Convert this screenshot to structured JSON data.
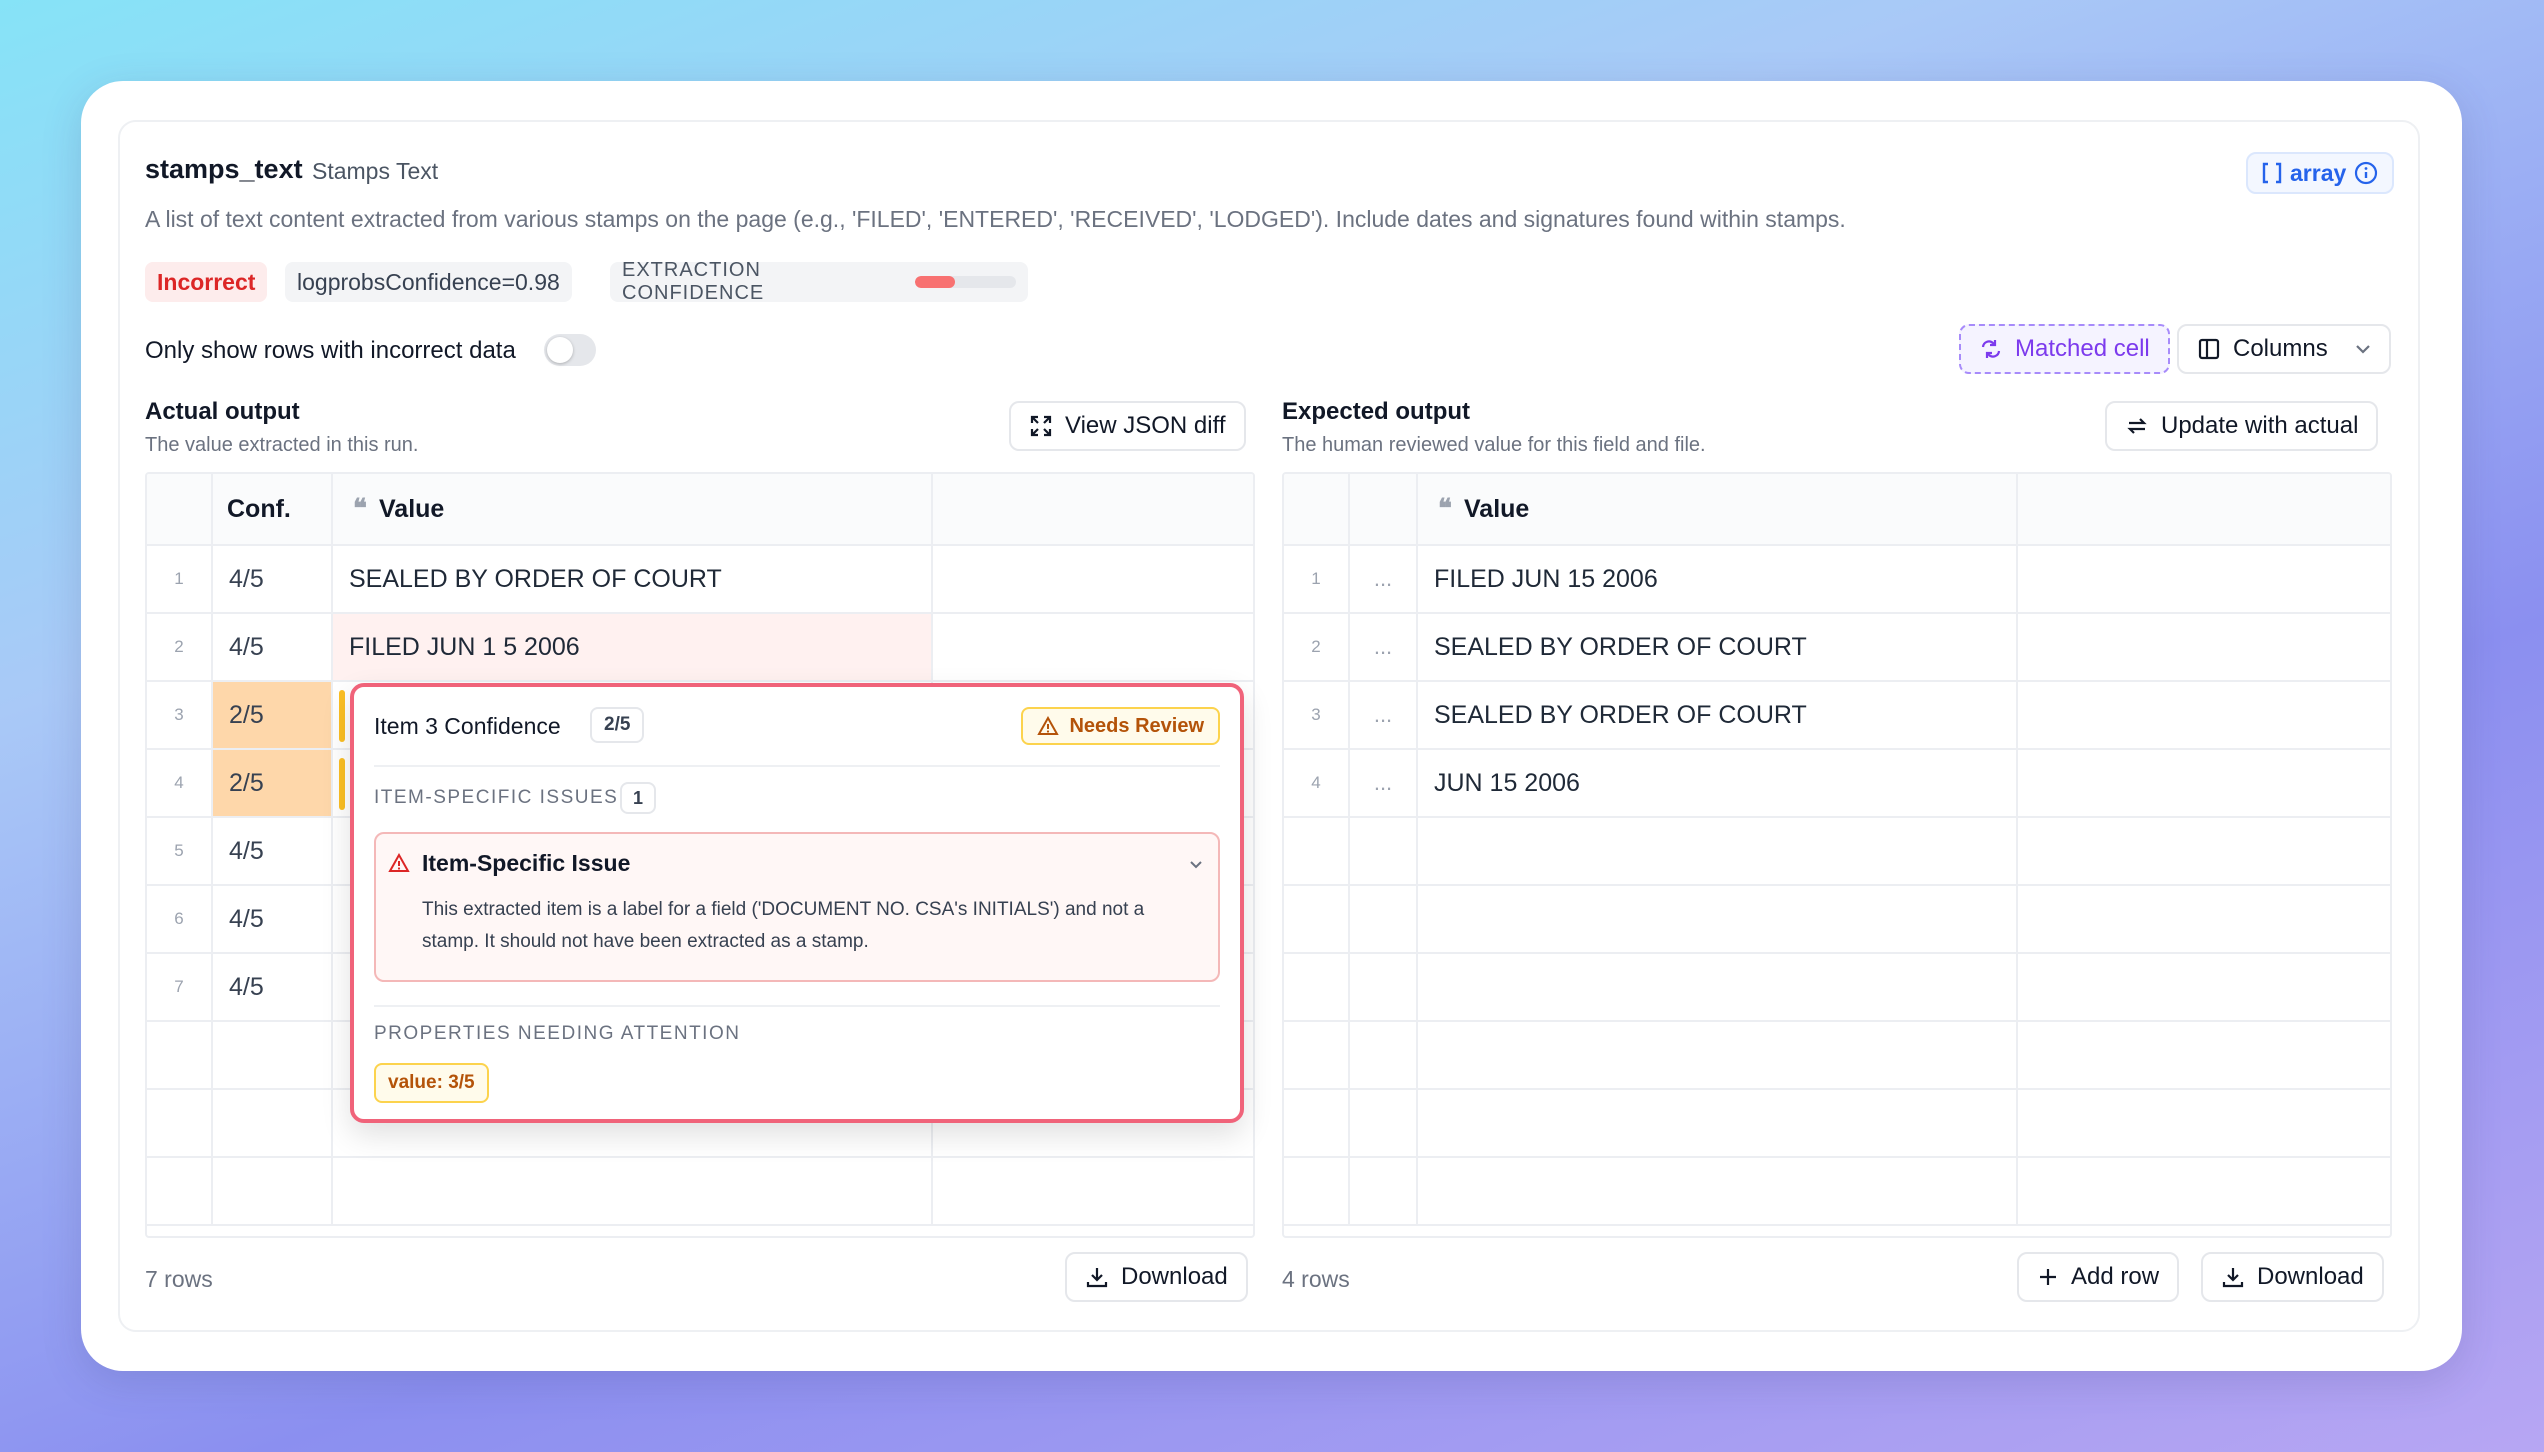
{
  "field": {
    "name": "stamps_text",
    "label": "Stamps Text",
    "description": "A list of text content extracted from various stamps on the page (e.g., 'FILED', 'ENTERED', 'RECEIVED', 'LODGED'). Include dates and signatures found within stamps.",
    "type_badge": "array"
  },
  "status": {
    "incorrect_label": "Incorrect",
    "logprobs": "logprobsConfidence=0.98",
    "extraction_label": "EXTRACTION CONFIDENCE",
    "extraction_level": 0.4,
    "bar_color": "#f87171"
  },
  "filter": {
    "toggle_label": "Only show rows with incorrect data",
    "enabled": false
  },
  "toolbar": {
    "matched_cell": "Matched cell",
    "columns": "Columns"
  },
  "actual": {
    "title": "Actual output",
    "subtitle": "The value extracted in this run.",
    "json_diff": "View JSON diff",
    "headers": {
      "conf": "Conf.",
      "value": "Value"
    },
    "rows": [
      {
        "idx": "1",
        "conf": "4/5",
        "value": "SEALED BY ORDER OF COURT"
      },
      {
        "idx": "2",
        "conf": "4/5",
        "value": "FILED JUN 1 5 2006"
      },
      {
        "idx": "3",
        "conf": "2/5",
        "value": ""
      },
      {
        "idx": "4",
        "conf": "2/5",
        "value": ""
      },
      {
        "idx": "5",
        "conf": "4/5",
        "value": ""
      },
      {
        "idx": "6",
        "conf": "4/5",
        "value": ""
      },
      {
        "idx": "7",
        "conf": "4/5",
        "value": ""
      }
    ],
    "row_count": "7 rows",
    "download": "Download"
  },
  "expected": {
    "title": "Expected output",
    "subtitle": "The human reviewed value for this field and file.",
    "update": "Update with actual",
    "headers": {
      "value": "Value"
    },
    "rows": [
      {
        "idx": "1",
        "dots": "...",
        "value": "FILED JUN 15 2006"
      },
      {
        "idx": "2",
        "dots": "...",
        "value": "SEALED BY ORDER OF COURT"
      },
      {
        "idx": "3",
        "dots": "...",
        "value": "SEALED BY ORDER OF COURT"
      },
      {
        "idx": "4",
        "dots": "...",
        "value": "JUN 15 2006"
      }
    ],
    "row_count": "4 rows",
    "add_row": "Add row",
    "download": "Download"
  },
  "popover": {
    "title": "Item 3 Confidence",
    "count": "2/5",
    "needs_review": "Needs Review",
    "issues_caption": "ITEM-SPECIFIC ISSUES",
    "issues_count": "1",
    "issue_title": "Item-Specific Issue",
    "issue_desc": "This extracted item is a label for a field ('DOCUMENT NO. CSA's INITIALS') and not a stamp. It should not have been extracted as a stamp.",
    "properties_caption": "PROPERTIES NEEDING ATTENTION",
    "property_badge": "value: 3/5"
  }
}
